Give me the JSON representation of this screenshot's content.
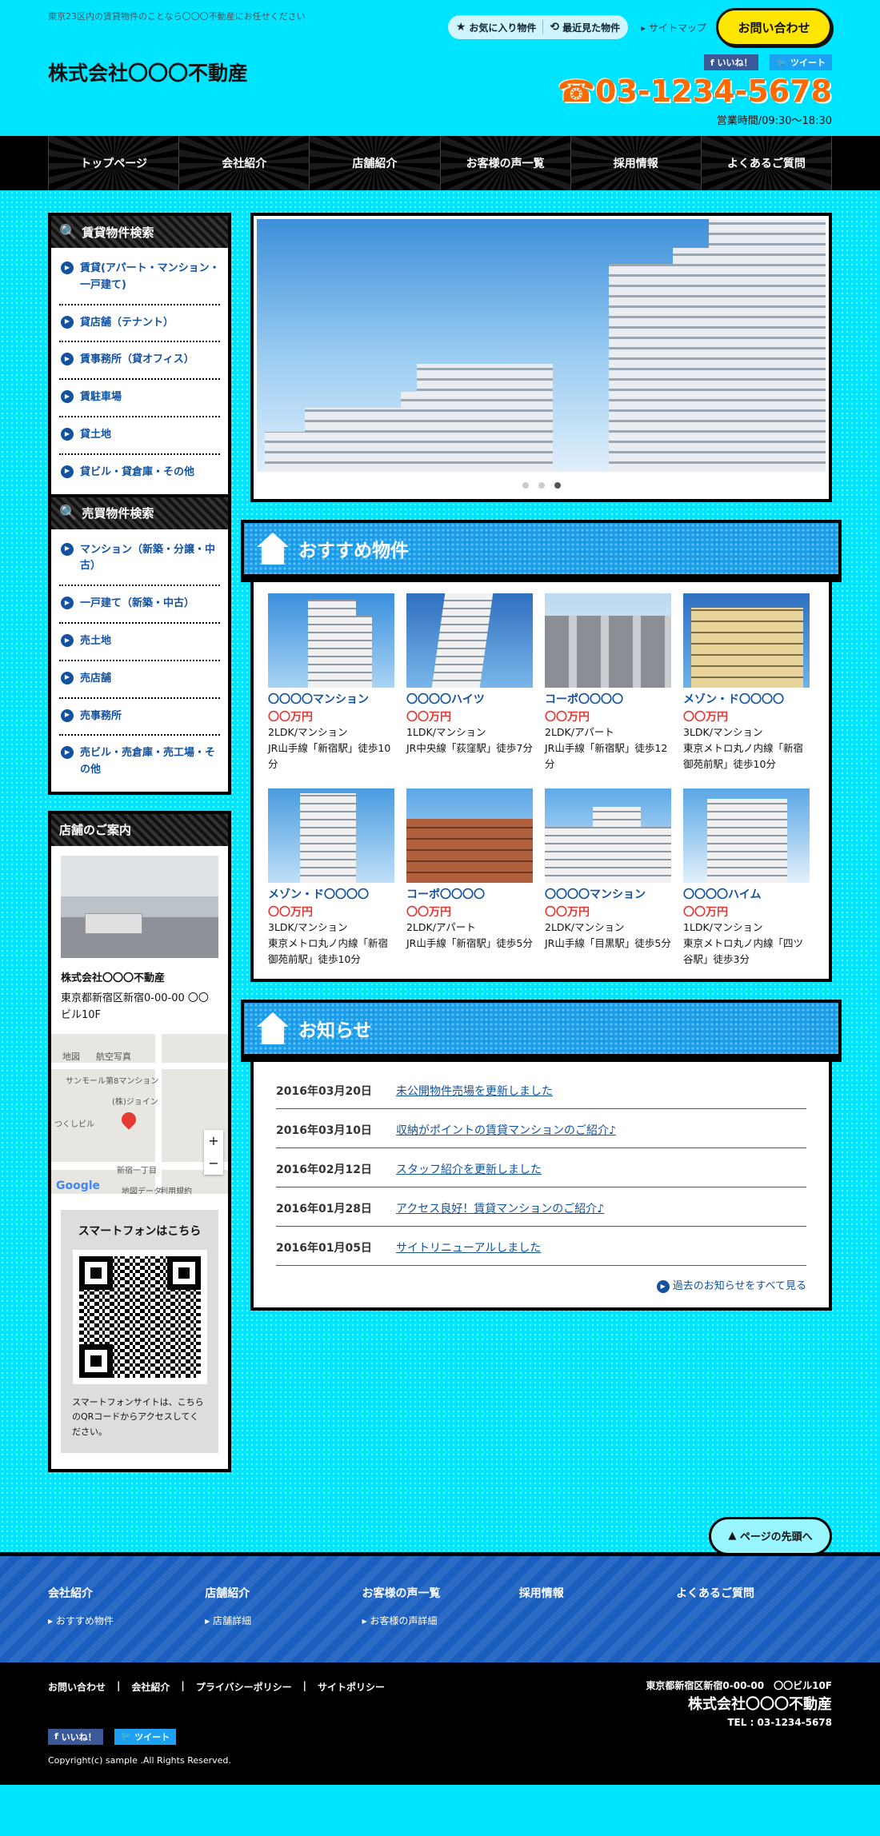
{
  "header": {
    "tagline": "東京23区内の賃貸物件のことなら〇〇〇不動産にお任せください",
    "logo": "株式会社〇〇〇不動産",
    "favorites": "お気に入り物件",
    "recent": "最近見た物件",
    "sitemap": "サイトマップ",
    "contact": "お問い合わせ",
    "like": "いいね！",
    "tweet": "ツイート",
    "tel": "03-1234-5678",
    "hours": "営業時間/09:30〜18:30"
  },
  "nav": [
    "トップページ",
    "会社紹介",
    "店舗紹介",
    "お客様の声一覧",
    "採用情報",
    "よくあるご質問"
  ],
  "sidebar": {
    "rent_title": "賃貸物件検索",
    "rent_items": [
      "賃貸(アパート・マンション・一戸建て)",
      "貸店舗（テナント）",
      "賃事務所（貸オフィス）",
      "賃駐車場",
      "貸土地",
      "貸ビル・貸倉庫・その他"
    ],
    "sale_title": "売買物件検索",
    "sale_items": [
      "マンション（新築・分譲・中古）",
      "一戸建て（新築・中古）",
      "売土地",
      "売店舗",
      "売事務所",
      "売ビル・売倉庫・売工場・その他"
    ],
    "shop_title": "店舗のご案内",
    "shop_name": "株式会社〇〇〇不動産",
    "shop_addr": "東京都新宿区新宿0-00-00 〇〇ビル10F",
    "map_labels": [
      "地図",
      "航空写真",
      "サンモール第8マンション",
      "(株)ジョイン",
      "つくしビル",
      "新宿一丁目",
      "利用規約",
      "地図データ",
      "Google"
    ],
    "sp_title": "スマートフォンはこちら",
    "sp_text": "スマートフォンサイトは、こちらのQRコードからアクセスしてください。"
  },
  "recommend": {
    "title": "おすすめ物件",
    "items": [
      {
        "name": "〇〇〇〇マンション",
        "price": "〇〇万円",
        "spec": "2LDK/マンション",
        "access": "JR山手線「新宿駅」徒歩10分"
      },
      {
        "name": "〇〇〇〇ハイツ",
        "price": "〇〇万円",
        "spec": "1LDK/マンション",
        "access": "JR中央線「荻窪駅」徒歩7分"
      },
      {
        "name": "コーポ〇〇〇〇",
        "price": "〇〇万円",
        "spec": "2LDK/アパート",
        "access": "JR山手線「新宿駅」徒歩12分"
      },
      {
        "name": "メゾン・ド〇〇〇〇",
        "price": "〇〇万円",
        "spec": "3LDK/マンション",
        "access": "東京メトロ丸ノ内線「新宿御苑前駅」徒歩10分"
      },
      {
        "name": "メゾン・ド〇〇〇〇",
        "price": "〇〇万円",
        "spec": "3LDK/マンション",
        "access": "東京メトロ丸ノ内線「新宿御苑前駅」徒歩10分"
      },
      {
        "name": "コーポ〇〇〇〇",
        "price": "〇〇万円",
        "spec": "2LDK/アパート",
        "access": "JR山手線「新宿駅」徒歩5分"
      },
      {
        "name": "〇〇〇〇マンション",
        "price": "〇〇万円",
        "spec": "2LDK/マンション",
        "access": "JR山手線「目黒駅」徒歩5分"
      },
      {
        "name": "〇〇〇〇ハイム",
        "price": "〇〇万円",
        "spec": "1LDK/マンション",
        "access": "東京メトロ丸ノ内線「四ツ谷駅」徒歩3分"
      }
    ]
  },
  "news": {
    "title": "お知らせ",
    "items": [
      {
        "date": "2016年03月20日",
        "text": "未公開物件売場を更新しました"
      },
      {
        "date": "2016年03月10日",
        "text": "収納がポイントの賃貸マンションのご紹介♪"
      },
      {
        "date": "2016年02月12日",
        "text": "スタッフ紹介を更新しました"
      },
      {
        "date": "2016年01月28日",
        "text": "アクセス良好！賃貸マンションのご紹介♪"
      },
      {
        "date": "2016年01月05日",
        "text": "サイトリニューアルしました"
      }
    ],
    "more": "過去のお知らせをすべて見る"
  },
  "footer": {
    "pagetop": "ページの先頭へ",
    "cols": [
      {
        "title": "会社紹介",
        "sub": "おすすめ物件"
      },
      {
        "title": "店舗紹介",
        "sub": "店舗詳細"
      },
      {
        "title": "お客様の声一覧",
        "sub": "お客様の声詳細"
      },
      {
        "title": "採用情報",
        "sub": ""
      },
      {
        "title": "よくあるご質問",
        "sub": ""
      }
    ],
    "links": [
      "お問い合わせ",
      "|",
      "会社紹介",
      "|",
      "プライバシーポリシー",
      "|",
      "サイトポリシー"
    ],
    "address": "東京都新宿区新宿0-00-00　〇〇ビル10F",
    "company": "株式会社〇〇〇不動産",
    "tel": "TEL : 03-1234-5678",
    "like": "いいね！",
    "tweet": "ツイート",
    "copyright": "Copyright(c) sample .All Rights Reserved."
  }
}
